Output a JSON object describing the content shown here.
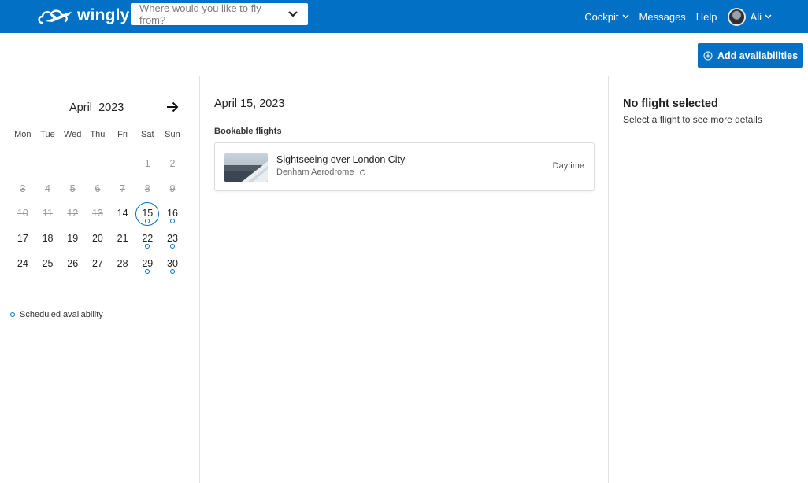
{
  "brand": {
    "name": "wingly"
  },
  "search": {
    "placeholder": "Where would you like to fly from?"
  },
  "nav": {
    "cockpit": "Cockpit",
    "messages": "Messages",
    "help": "Help",
    "user": "Ali"
  },
  "toolbar": {
    "add_label": "Add availabilities"
  },
  "calendar": {
    "month": "April  2023",
    "weekdays": [
      "Mon",
      "Tue",
      "Wed",
      "Thu",
      "Fri",
      "Sat",
      "Sun"
    ],
    "leading_blanks": 5,
    "days": [
      {
        "d": "1",
        "past": true,
        "dot": false
      },
      {
        "d": "2",
        "past": true,
        "dot": false
      },
      {
        "d": "3",
        "past": true,
        "dot": false
      },
      {
        "d": "4",
        "past": true,
        "dot": false
      },
      {
        "d": "5",
        "past": true,
        "dot": false
      },
      {
        "d": "6",
        "past": true,
        "dot": false
      },
      {
        "d": "7",
        "past": true,
        "dot": false
      },
      {
        "d": "8",
        "past": true,
        "dot": false
      },
      {
        "d": "9",
        "past": true,
        "dot": false
      },
      {
        "d": "10",
        "past": true,
        "dot": false
      },
      {
        "d": "11",
        "past": true,
        "dot": false
      },
      {
        "d": "12",
        "past": true,
        "dot": false
      },
      {
        "d": "13",
        "past": true,
        "dot": false
      },
      {
        "d": "14",
        "past": false,
        "dot": false
      },
      {
        "d": "15",
        "past": false,
        "dot": true,
        "selected": true
      },
      {
        "d": "16",
        "past": false,
        "dot": true
      },
      {
        "d": "17",
        "past": false,
        "dot": false
      },
      {
        "d": "18",
        "past": false,
        "dot": false
      },
      {
        "d": "19",
        "past": false,
        "dot": false
      },
      {
        "d": "20",
        "past": false,
        "dot": false
      },
      {
        "d": "21",
        "past": false,
        "dot": false
      },
      {
        "d": "22",
        "past": false,
        "dot": true
      },
      {
        "d": "23",
        "past": false,
        "dot": true
      },
      {
        "d": "24",
        "past": false,
        "dot": false
      },
      {
        "d": "25",
        "past": false,
        "dot": false
      },
      {
        "d": "26",
        "past": false,
        "dot": false
      },
      {
        "d": "27",
        "past": false,
        "dot": false
      },
      {
        "d": "28",
        "past": false,
        "dot": false
      },
      {
        "d": "29",
        "past": false,
        "dot": true
      },
      {
        "d": "30",
        "past": false,
        "dot": true
      }
    ],
    "legend": "Scheduled availability"
  },
  "main": {
    "date_title": "April 15, 2023",
    "section_label": "Bookable flights",
    "flights": [
      {
        "title": "Sightseeing over London City",
        "airfield": "Denham Aerodrome",
        "time": "Daytime"
      }
    ]
  },
  "details": {
    "title": "No flight selected",
    "subtitle": "Select a flight to see more details"
  },
  "colors": {
    "brand": "#0270c4",
    "border": "#e3e3e3"
  }
}
